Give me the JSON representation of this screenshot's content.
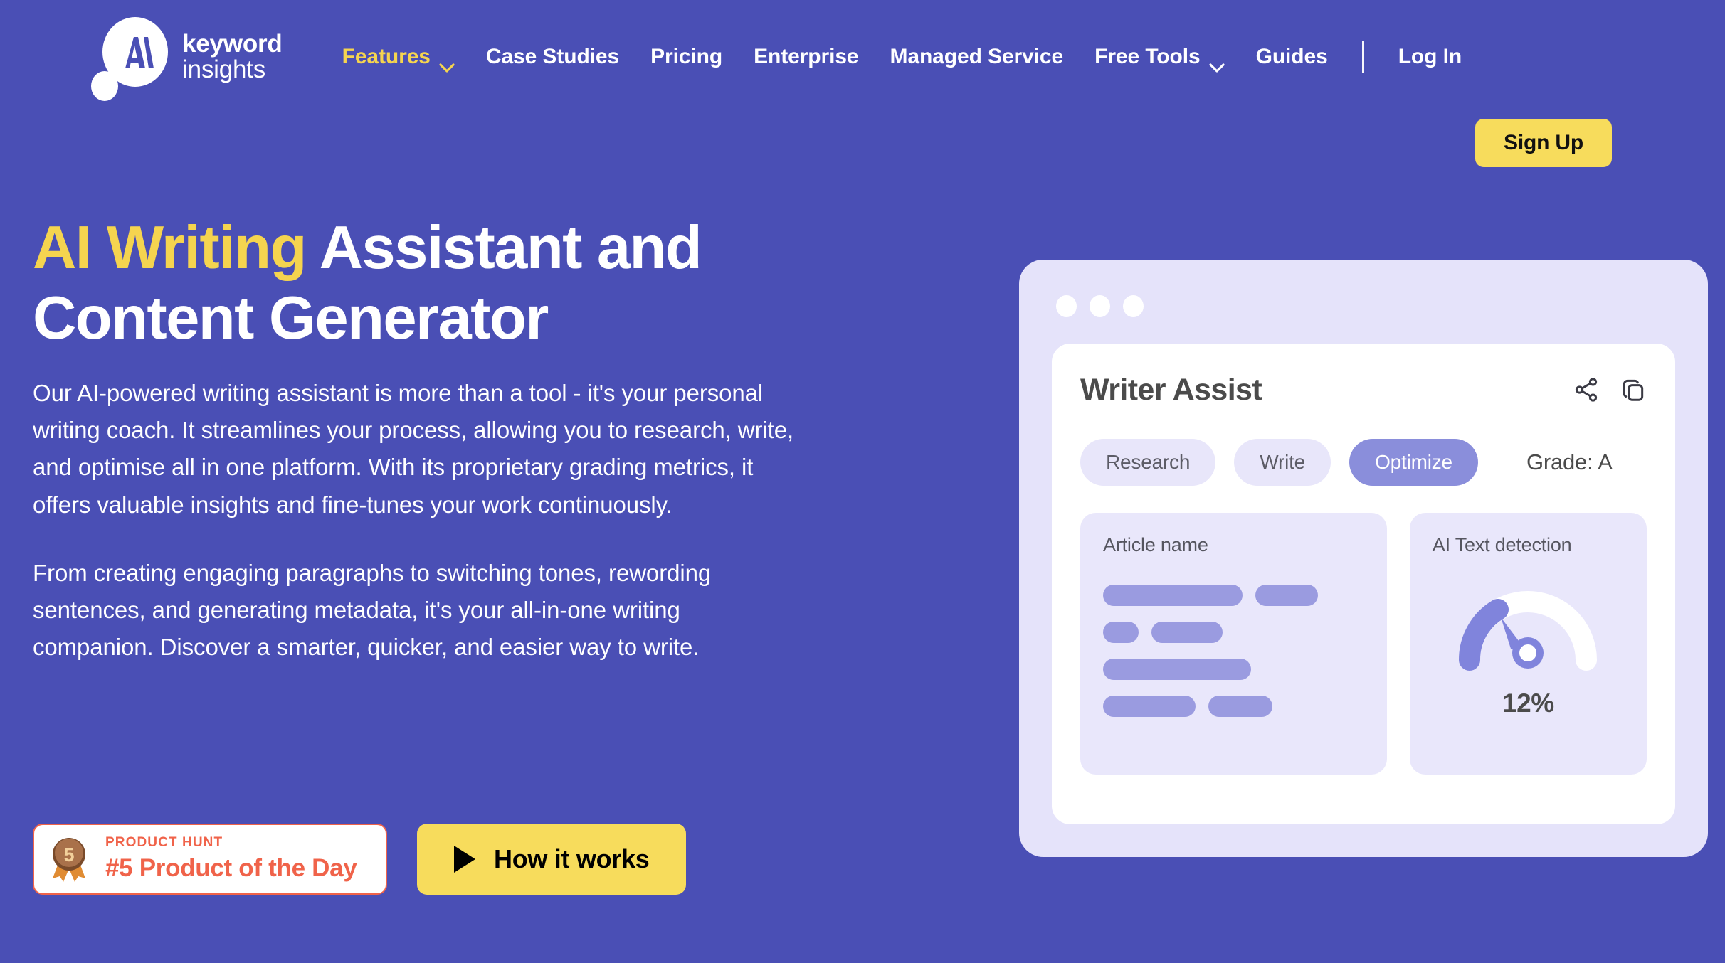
{
  "brand": {
    "logo_line1": "keyword",
    "logo_line2": "insights",
    "logo_icon": "keyword-insights-logo"
  },
  "colors": {
    "background": "#4A4FB5",
    "accent_yellow": "#F5D44F",
    "button_yellow": "#F7DC5C",
    "product_hunt_red": "#F0634A",
    "mockup_frame": "#E5E3FA",
    "panel_lavender": "#E9E7FB",
    "skeleton_purple": "#9A9BE0",
    "pill_selected": "#8A8EDB",
    "white": "#FFFFFF"
  },
  "nav": {
    "items": [
      {
        "label": "Features",
        "has_dropdown": true,
        "active": true
      },
      {
        "label": "Case Studies",
        "has_dropdown": false,
        "active": false
      },
      {
        "label": "Pricing",
        "has_dropdown": false,
        "active": false
      },
      {
        "label": "Enterprise",
        "has_dropdown": false,
        "active": false
      },
      {
        "label": "Managed Service",
        "has_dropdown": false,
        "active": false
      },
      {
        "label": "Free Tools",
        "has_dropdown": true,
        "active": false
      },
      {
        "label": "Guides",
        "has_dropdown": false,
        "active": false
      }
    ],
    "login_label": "Log In",
    "signup_label": "Sign Up"
  },
  "hero": {
    "headline_highlight": "AI Writing",
    "headline_rest": " Assistant and Content Generator",
    "paragraph_1": "Our AI-powered writing assistant is more than a tool - it's your personal writing coach. It streamlines your process, allowing you to research, write, and optimise all in one platform. With its proprietary grading metrics, it offers valuable insights and fine-tunes your work continuously.",
    "paragraph_2": "From creating engaging paragraphs to switching tones, rewording sentences, and generating metadata, it's your all-in-one writing companion. Discover a smarter, quicker, and easier way to write."
  },
  "product_hunt": {
    "kicker": "PRODUCT HUNT",
    "title": "#5 Product of the Day",
    "medal_rank": "5"
  },
  "how_it_works": {
    "label": "How it works",
    "icon": "play-icon"
  },
  "mockup": {
    "window_dots": 3,
    "card_title": "Writer Assist",
    "actions": [
      {
        "name": "share-icon"
      },
      {
        "name": "copy-icon"
      }
    ],
    "tabs": [
      {
        "label": "Research",
        "selected": false
      },
      {
        "label": "Write",
        "selected": false
      },
      {
        "label": "Optimize",
        "selected": true
      }
    ],
    "grade_label": "Grade: A",
    "article_panel": {
      "title": "Article name",
      "skeleton_rows": [
        [
          196,
          88
        ],
        [
          50,
          100
        ],
        [
          208
        ],
        [
          130,
          90
        ]
      ]
    },
    "detection_panel": {
      "title": "AI Text detection",
      "value": "12%",
      "gauge_percent": 12
    }
  }
}
